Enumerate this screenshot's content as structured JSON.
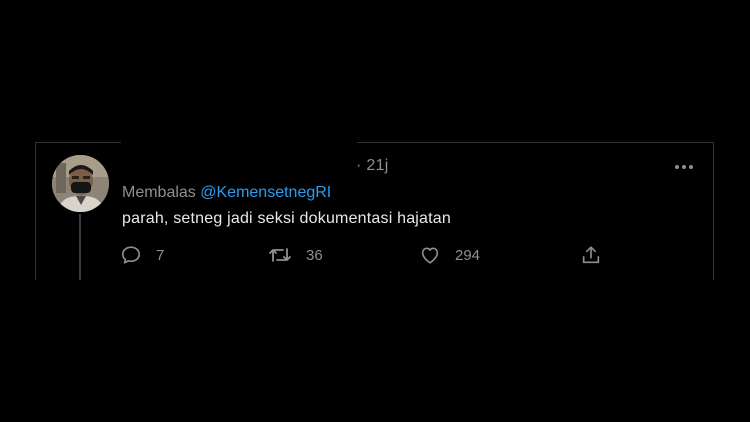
{
  "tweet": {
    "time": "· 21j",
    "reply_prefix": "Membalas",
    "reply_handle": "@KemensetnegRI",
    "text": "parah, setneg jadi seksi dokumentasi hajatan",
    "actions": {
      "reply_count": "7",
      "retweet_count": "36",
      "like_count": "294"
    }
  },
  "colors": {
    "background": "#000000",
    "link": "#2b9bf0",
    "muted": "#8b9095",
    "text": "#e7e9ea"
  }
}
